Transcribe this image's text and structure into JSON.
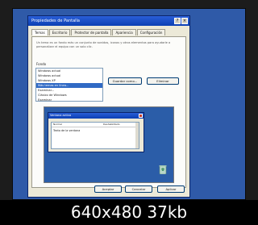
{
  "dialog": {
    "title": "Propiedades de Pantalla",
    "tabs": [
      "Temas",
      "Escritorio",
      "Protector de pantalla",
      "Apariencia",
      "Configuración"
    ],
    "active_tab": 0,
    "help_text": "Un tema es un fondo más un conjunto de sonidos, iconos y otros elementos para ayudarle a personalizar el equipo con un solo clic.",
    "fondo_label": "Fondo",
    "fondo_items": [
      "Windows actual",
      "Windows actual",
      "Windows XP",
      "Más temas en línea...",
      "Examinar...",
      "Clásico de Windows",
      "Examinar"
    ],
    "selected_index": 3,
    "save_label": "Guardar como...",
    "delete_label": "Eliminar",
    "preview": {
      "window_title": "Ventana activa",
      "column1": "Normal",
      "column2": "Deshabilitado",
      "cell": "Texto de la ventana"
    },
    "ok_label": "Aceptar",
    "cancel_label": "Cancelar",
    "apply_label": "Aplicar"
  },
  "image_info": {
    "dims": "640x480 37kb"
  },
  "colors": {
    "desktop_blue": "#2f5aa8",
    "titlebar_blue": "#0b3fb3",
    "selection_blue": "#316ac5"
  }
}
